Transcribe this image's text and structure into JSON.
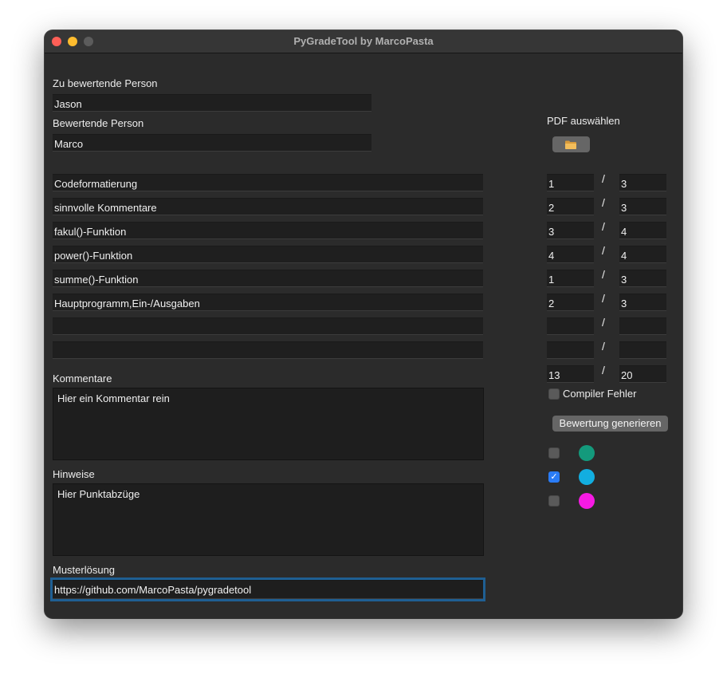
{
  "window": {
    "title": "PyGradeTool by MarcoPasta"
  },
  "left": {
    "person_label": "Zu bewertende Person",
    "person_value": "Jason",
    "grader_label": "Bewertende Person",
    "grader_value": "Marco",
    "criteria": [
      "Codeformatierung",
      "sinnvolle Kommentare",
      "fakul()-Funktion",
      "power()-Funktion",
      "summe()-Funktion",
      "Hauptprogramm,Ein-/Ausgaben",
      "",
      ""
    ],
    "comments_label": "Kommentare",
    "comments_value": "Hier ein Kommentar rein",
    "hints_label": "Hinweise",
    "hints_value": "Hier Punktabzüge",
    "solution_label": "Musterlösung",
    "solution_value": "https://github.com/MarcoPasta/pygradetool"
  },
  "right": {
    "pdf_label": "PDF auswählen",
    "pdf_button_icon": "folder-icon",
    "scores": [
      {
        "got": "1",
        "max": "3"
      },
      {
        "got": "2",
        "max": "3"
      },
      {
        "got": "3",
        "max": "4"
      },
      {
        "got": "4",
        "max": "4"
      },
      {
        "got": "1",
        "max": "3"
      },
      {
        "got": "2",
        "max": "3"
      },
      {
        "got": "",
        "max": ""
      },
      {
        "got": "",
        "max": ""
      }
    ],
    "total": {
      "got": "13",
      "max": "20"
    },
    "slash": "/",
    "compiler_error_label": "Compiler Fehler",
    "compiler_error_checked": false,
    "generate_button": "Bewertung generieren",
    "colors": [
      {
        "color": "#149a7c",
        "checked": false
      },
      {
        "color": "#12aee0",
        "checked": true
      },
      {
        "color": "#f61ae4",
        "checked": false
      }
    ]
  }
}
